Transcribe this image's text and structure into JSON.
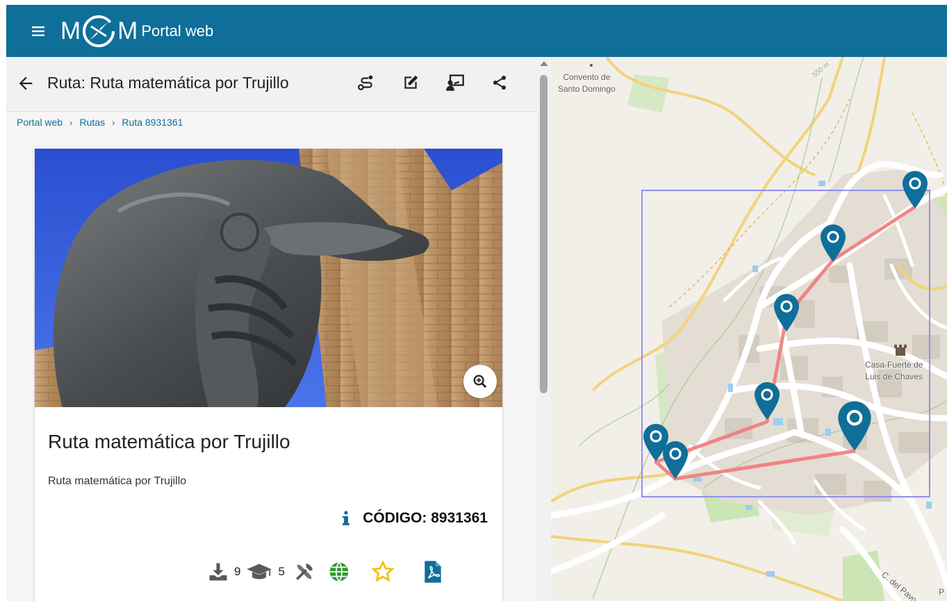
{
  "header": {
    "logo_letter_left": "M",
    "logo_letter_right": "M",
    "title": "Portal web",
    "bar_color": "#0f6f99"
  },
  "toolbar": {
    "title": "Ruta: Ruta matemática por Trujillo",
    "icons": [
      "route-icon",
      "edit-icon",
      "presentation-icon",
      "share-icon"
    ]
  },
  "breadcrumb": {
    "items": [
      "Portal web",
      "Rutas",
      "Ruta 8931361"
    ],
    "separator": "›"
  },
  "card": {
    "title": "Ruta matemática por Trujillo",
    "description": "Ruta matemática por Trujillo",
    "code": "CÓDIGO: 8931361",
    "downloads": "9",
    "grade": "5",
    "icon_colors": {
      "stats": "#5a5a5a",
      "globe": "#2f9c2f",
      "star": "#f2c200",
      "pdf": "#0f6f99",
      "info": "#0f6f99"
    }
  },
  "map": {
    "labels": [
      "Convento de",
      "Santo Domingo",
      "Casa-Fuerte de",
      "Luis de Chaves",
      "550 m",
      "C. del Pavo",
      "P"
    ],
    "route_color": "#f07a7a",
    "marker_color": "#0f6f99",
    "bbox_color": "#8f8ff0",
    "marker_count": 7
  }
}
